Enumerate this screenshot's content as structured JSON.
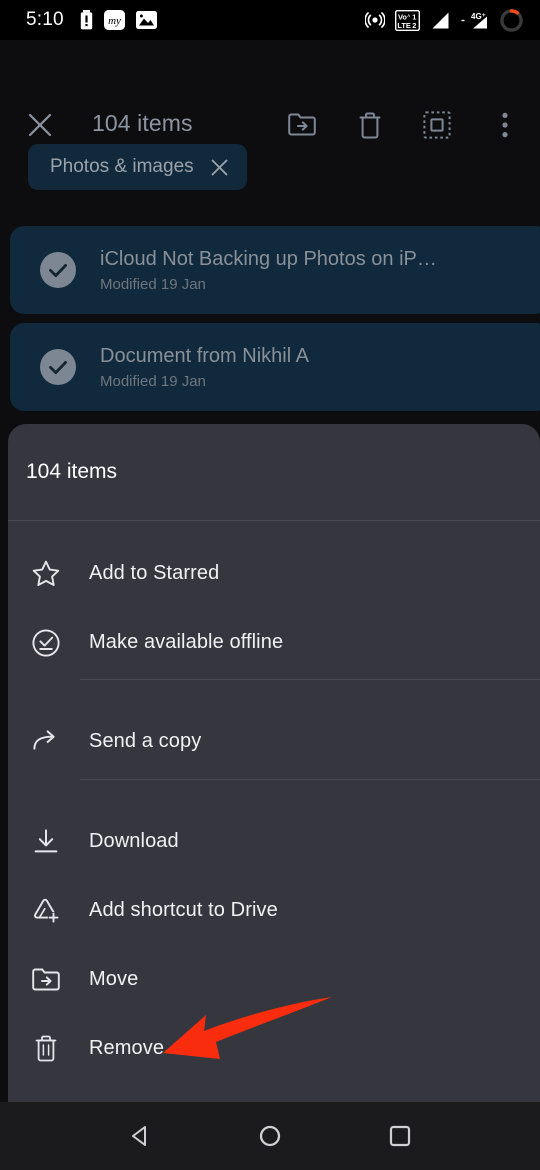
{
  "status_bar": {
    "time": "5:10",
    "left_icons": [
      "battery-alert-icon",
      "my-app-icon",
      "image-icon"
    ],
    "right_icons": [
      "hotspot-icon",
      "volte-lte-dual-sim-icon",
      "signal-bars-icon",
      "4g-plus-signal-icon",
      "battery-ring-icon"
    ],
    "network_label_top": "VoLTE 1",
    "network_label_bottom": "LTE 2",
    "network_type": "4G+",
    "accent": "#ff4a1c"
  },
  "toolbar": {
    "close_label": "close-icon",
    "title": "104 items",
    "actions": [
      {
        "name": "move-to-folder-button",
        "icon": "folder-arrow-icon"
      },
      {
        "name": "delete-button",
        "icon": "trash-icon"
      },
      {
        "name": "select-all-button",
        "icon": "select-all-icon"
      },
      {
        "name": "more-options-button",
        "icon": "overflow-menu-icon"
      }
    ]
  },
  "filter": {
    "chip_label": "Photos & images",
    "chip_close_icon": "close-icon",
    "chip_bg": "#11293a"
  },
  "files": [
    {
      "title": "iCloud Not Backing up Photos on iP…",
      "subtitle": "Modified 19 Jan",
      "selected": true
    },
    {
      "title": "Document from Nikhil A",
      "subtitle": "Modified 19 Jan",
      "selected": true
    }
  ],
  "sheet": {
    "title": "104 items",
    "background": "#36363e",
    "menu_items": [
      {
        "label": "Add to Starred",
        "icon": "star-outline-icon"
      },
      {
        "label": "Make available offline",
        "icon": "offline-check-icon"
      },
      {
        "label": "Send a copy",
        "icon": "share-arrow-icon"
      },
      {
        "label": "Download",
        "icon": "download-icon"
      },
      {
        "label": "Add shortcut to Drive",
        "icon": "drive-shortcut-add-icon"
      },
      {
        "label": "Move",
        "icon": "folder-arrow-icon"
      },
      {
        "label": "Remove",
        "icon": "trash-icon"
      }
    ]
  },
  "annotation": {
    "arrow_color": "#f92d0e",
    "points_to": "Remove"
  },
  "nav_bar": {
    "buttons": [
      {
        "name": "back-button",
        "icon": "triangle-back-icon"
      },
      {
        "name": "home-button",
        "icon": "circle-home-icon"
      },
      {
        "name": "recents-button",
        "icon": "square-recents-icon"
      }
    ]
  }
}
